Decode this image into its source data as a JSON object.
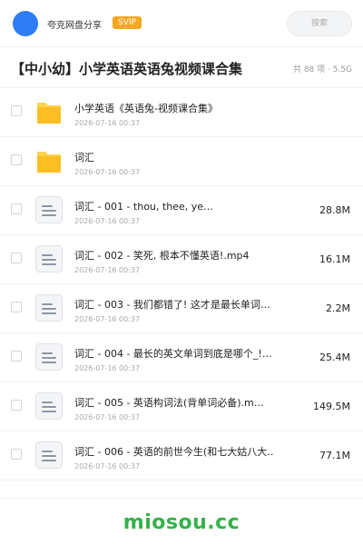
{
  "header": {
    "username": "夸克网盘分享",
    "badge": "SVIP",
    "search_label": "搜索",
    "avatar_color": "#2e7cf6",
    "badge_color": "#f5a623"
  },
  "share": {
    "title": "【中小幼】小学英语英语兔视频课合集",
    "meta": "共 88 项 · 5.5G"
  },
  "items": [
    {
      "type": "folder",
      "name": "小学英语《英语兔-视频课合集》",
      "date": "2026-07-16 00:37",
      "size": "",
      "icon": "folder-icon"
    },
    {
      "type": "folder",
      "name": "词汇",
      "date": "2026-07-16 00:37",
      "size": "",
      "icon": "folder-icon"
    },
    {
      "type": "file",
      "name": "词汇 - 001 - thou, thee, ye…",
      "date": "2026-07-16 00:37",
      "size": "28.8M",
      "icon": "file-icon"
    },
    {
      "type": "file",
      "name": "词汇 - 002 - 笑死, 根本不懂英语!.mp4",
      "date": "2026-07-16 00:37",
      "size": "16.1M",
      "icon": "file-icon"
    },
    {
      "type": "file",
      "name": "词汇 - 003 - 我们都错了! 这才是最长单词…",
      "date": "2026-07-16 00:37",
      "size": "2.2M",
      "icon": "file-icon"
    },
    {
      "type": "file",
      "name": "词汇 - 004 - 最长的英文单词到底是哪个_!…",
      "date": "2026-07-16 00:37",
      "size": "25.4M",
      "icon": "file-icon"
    },
    {
      "type": "file",
      "name": "词汇 - 005 - 英语构词法(背单词必备).m…",
      "date": "2026-07-16 00:37",
      "size": "149.5M",
      "icon": "file-icon"
    },
    {
      "type": "file",
      "name": "词汇 - 006 - 英语的前世今生(和七大姑八大…",
      "date": "2026-07-16 00:37",
      "size": "77.1M",
      "icon": "file-icon"
    }
  ],
  "footer": {
    "watermark": "miosou.cc",
    "watermark_color": "#33b24a"
  }
}
